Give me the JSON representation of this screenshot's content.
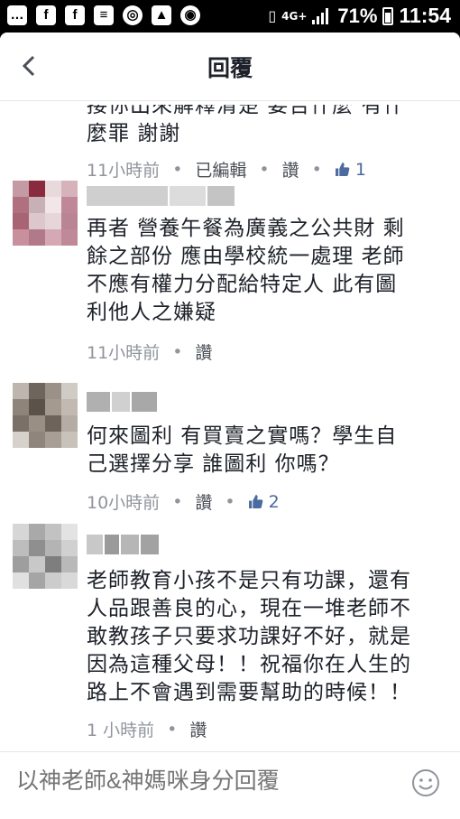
{
  "status_bar": {
    "app_icons": [
      "f",
      "f",
      "message-icon",
      "q-icon",
      "image-icon",
      "chrome-icon"
    ],
    "network": "4G+",
    "battery": "71%",
    "time": "11:54"
  },
  "header": {
    "title": "回覆"
  },
  "comments": [
    {
      "text_line1": "接你出來解釋清楚 要告什麼 有什",
      "text_line2": "麼罪 謝謝",
      "time": "11小時前",
      "edited": "已編輯",
      "like_label": "讚",
      "like_count": "1"
    },
    {
      "text": [
        "再者 營養午餐為廣義之公共財 剩",
        "餘之部份 應由學校統一處理 老師",
        "不應有權力分配給特定人 此有圖",
        "利他人之嫌疑"
      ],
      "time": "11小時前",
      "like_label": "讚"
    },
    {
      "text": [
        "何來圖利 有買賣之實嗎？學生自",
        "己選擇分享 誰圖利 你嗎？"
      ],
      "time": "10小時前",
      "like_label": "讚",
      "like_count": "2"
    },
    {
      "text": [
        "老師教育小孩不是只有功課，還有",
        "人品跟善良的心，現在一堆老師不",
        "敢教孩子只要求功課好不好，就是",
        "因為這種父母！！祝福你在人生的",
        "路上不會遇到需要幫助的時候！！"
      ],
      "time": "1 小時前",
      "like_label": "讚"
    }
  ],
  "footer": {
    "placeholder": "以神老師&神媽咪身分回覆"
  },
  "colors": {
    "text": "#1d2129",
    "meta": "#90949c",
    "like_blue": "#4b6aa0"
  }
}
